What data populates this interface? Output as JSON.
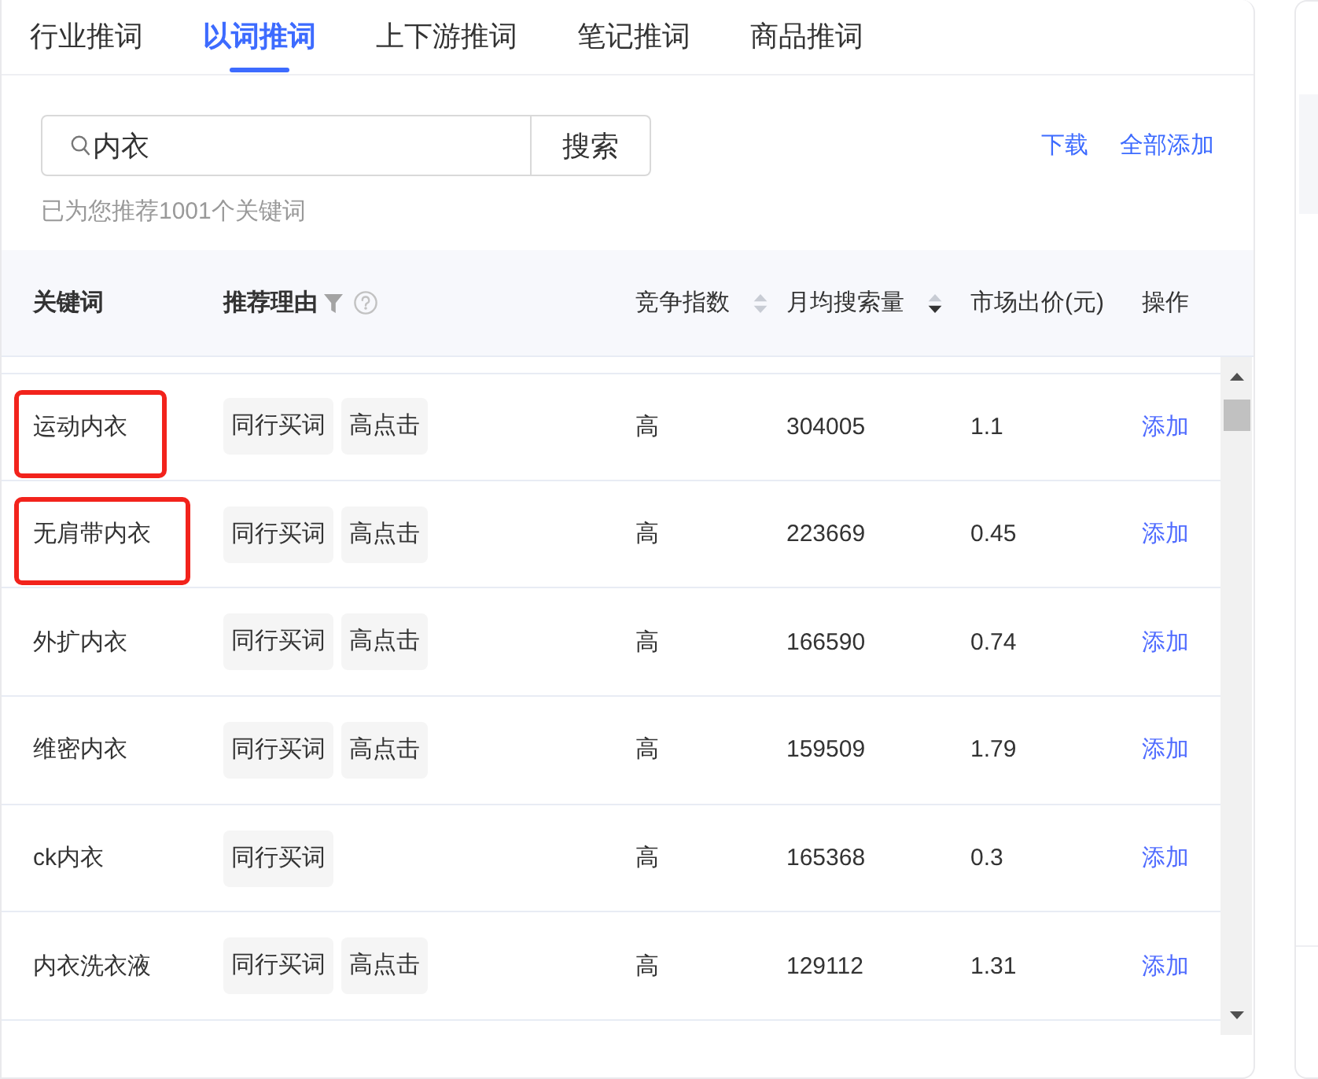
{
  "tabs": [
    {
      "label": "行业推词",
      "selected": false
    },
    {
      "label": "以词推词",
      "selected": true
    },
    {
      "label": "上下游推词",
      "selected": false
    },
    {
      "label": "笔记推词",
      "selected": false
    },
    {
      "label": "商品推词",
      "selected": false
    }
  ],
  "search": {
    "value": "内衣",
    "button": "搜索"
  },
  "actions": [
    "下载",
    "全部添加"
  ],
  "hint": "已为您推荐1001个关键词",
  "table": {
    "columns": [
      {
        "label": "关键词",
        "kind": "plain",
        "bold": true
      },
      {
        "label": "推荐理由",
        "kind": "filter",
        "bold": true
      },
      {
        "label": "竞争指数",
        "kind": "sortable",
        "bold": false,
        "sorted_descending": false
      },
      {
        "label": "月均搜索量",
        "kind": "sortable",
        "bold": false,
        "sorted_descending": true
      },
      {
        "label": "市场出价(元)",
        "kind": "plain",
        "bold": false
      },
      {
        "label": "操作",
        "kind": "plain",
        "bold": false
      }
    ],
    "rows": [
      {
        "keyword": "运动内衣",
        "highlighted": true,
        "reasons": [
          "同行买词",
          "高点击"
        ],
        "competition": "高",
        "monthly_searches": "304005",
        "market_bid": "1.1",
        "action": "添加"
      },
      {
        "keyword": "无肩带内衣",
        "highlighted": true,
        "reasons": [
          "同行买词",
          "高点击"
        ],
        "competition": "高",
        "monthly_searches": "223669",
        "market_bid": "0.45",
        "action": "添加"
      },
      {
        "keyword": "外扩内衣",
        "highlighted": false,
        "reasons": [
          "同行买词",
          "高点击"
        ],
        "competition": "高",
        "monthly_searches": "166590",
        "market_bid": "0.74",
        "action": "添加"
      },
      {
        "keyword": "维密内衣",
        "highlighted": false,
        "reasons": [
          "同行买词",
          "高点击"
        ],
        "competition": "高",
        "monthly_searches": "159509",
        "market_bid": "1.79",
        "action": "添加"
      },
      {
        "keyword": "ck内衣",
        "highlighted": false,
        "reasons": [
          "同行买词"
        ],
        "competition": "高",
        "monthly_searches": "165368",
        "market_bid": "0.3",
        "action": "添加"
      },
      {
        "keyword": "内衣洗衣液",
        "highlighted": false,
        "reasons": [
          "同行买词",
          "高点击"
        ],
        "competition": "高",
        "monthly_searches": "129112",
        "market_bid": "1.31",
        "action": "添加"
      }
    ]
  }
}
